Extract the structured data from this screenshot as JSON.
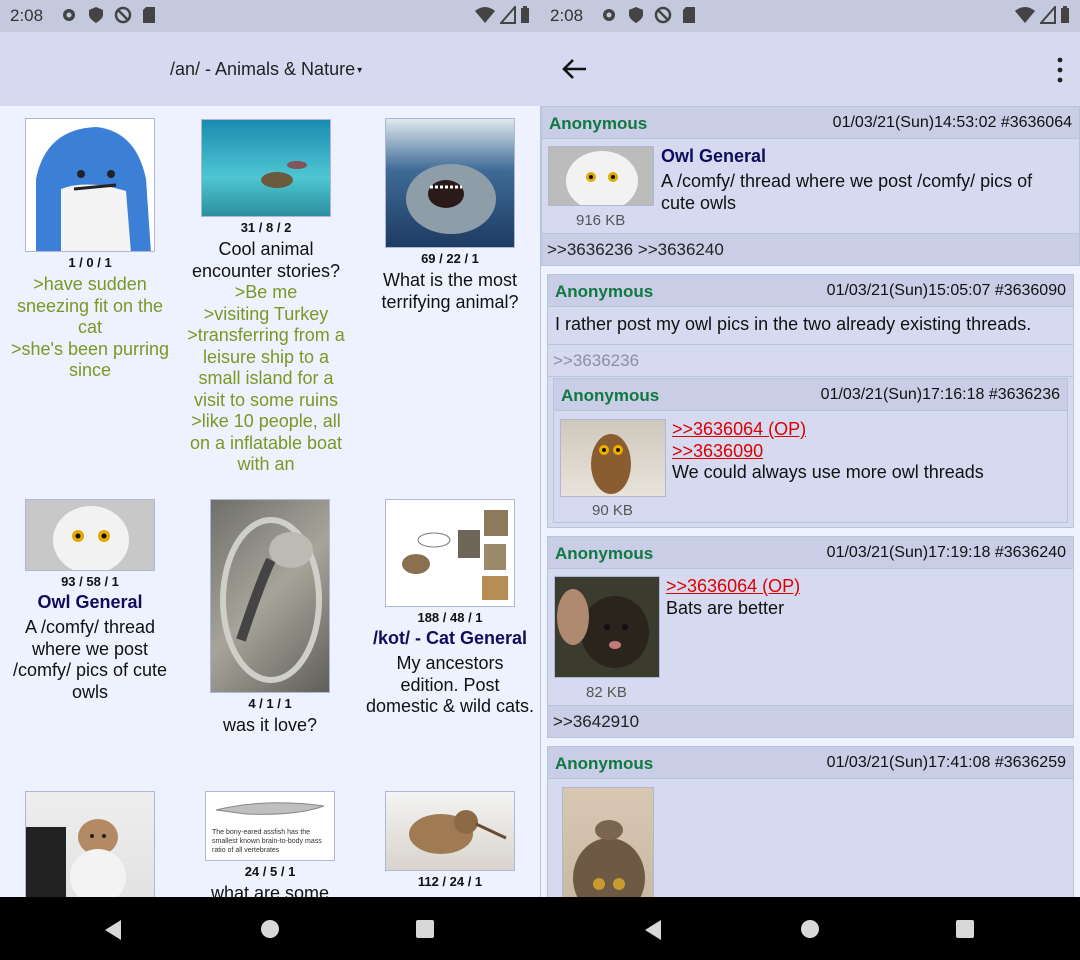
{
  "status_left": {
    "time": "2:08"
  },
  "status_right": {
    "time": "2:08"
  },
  "board": {
    "title": "/an/ - Animals & Nature",
    "caret": "▾"
  },
  "catalog": [
    {
      "stats": "1 / 0 / 1",
      "subject": "",
      "lines": [
        ">have sudden sneezing fit on the cat",
        ">she's been purring since"
      ],
      "greentext": true
    },
    {
      "stats": "31 / 8 / 2",
      "subject": "",
      "lines": [
        "Cool animal encounter stories?",
        ">Be me",
        ">visiting Turkey",
        ">transferring from a leisure ship to a small island for a visit to some ruins",
        ">like 10 people, all on a inflatable boat with an"
      ],
      "greentext": "mixed"
    },
    {
      "stats": "69 / 22 / 1",
      "subject": "",
      "lines": [
        "What is the most terrifying animal?"
      ]
    },
    {
      "stats": "93 / 58 / 1",
      "subject": "Owl General",
      "lines": [
        "A /comfy/ thread where we post /comfy/ pics of cute owls"
      ]
    },
    {
      "stats": "4 / 1 / 1",
      "subject": "",
      "lines": [
        "was it love?"
      ]
    },
    {
      "stats": "188 / 48 / 1",
      "subject": "/kot/ - Cat General",
      "lines": [
        "My ancestors edition. Post domestic & wild cats."
      ]
    },
    {
      "stats": "",
      "subject": "",
      "lines": []
    },
    {
      "stats": "24 / 5 / 1",
      "subject": "",
      "lines": [
        "what are some"
      ]
    },
    {
      "stats": "112 / 24 / 1",
      "subject": "",
      "lines": []
    }
  ],
  "assfish_caption": "The bony-eared assfish has the smallest known brain-to-body mass ratio of all vertebrates",
  "posts": [
    {
      "name": "Anonymous",
      "datetime": "01/03/21(Sun)14:53:02",
      "number": "#3636064",
      "subject": "Owl General",
      "text": "A /comfy/ thread where we post /comfy/ pics of cute owls",
      "filesize": "916 KB",
      "replies": ">>3636236 >>3636240"
    },
    {
      "name": "Anonymous",
      "datetime": "01/03/21(Sun)15:05:07",
      "number": "#3636090",
      "text": "I rather post my owl pics in the two already existing threads.",
      "backlink": ">>3636236"
    },
    {
      "name": "Anonymous",
      "datetime": "01/03/21(Sun)17:16:18",
      "number": "#3636236",
      "quote1": ">>3636064 (OP)",
      "quote2": ">>3636090",
      "text": "We could always use more owl threads",
      "filesize": "90 KB"
    },
    {
      "name": "Anonymous",
      "datetime": "01/03/21(Sun)17:19:18",
      "number": "#3636240",
      "quote1": ">>3636064 (OP)",
      "text": "Bats are better",
      "filesize": "82 KB",
      "replies": ">>3642910"
    },
    {
      "name": "Anonymous",
      "datetime": "01/03/21(Sun)17:41:08",
      "number": "#3636259"
    }
  ],
  "colors": {
    "name": "#117743",
    "subject": "#0f0c5d",
    "greentext": "#789922",
    "quote": "#dd0000",
    "post_bg": "#d6daf0",
    "page_bg": "#eef2ff"
  },
  "icons": [
    "settings-icon",
    "shield-icon",
    "no-disturb-icon",
    "sdcard-icon",
    "wifi-icon",
    "signal-icon",
    "battery-icon",
    "back-arrow-icon",
    "more-vert-icon",
    "nav-back-icon",
    "nav-home-icon",
    "nav-recents-icon"
  ]
}
